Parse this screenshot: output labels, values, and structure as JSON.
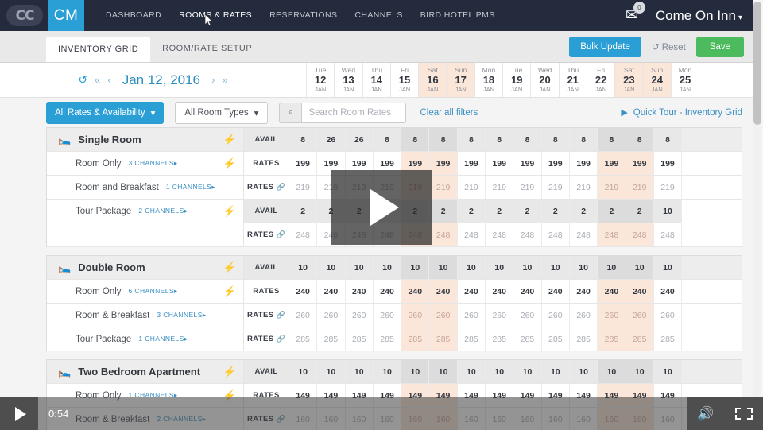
{
  "topnav": {
    "logo_cc": "CC",
    "logo_cm": "CM",
    "items": [
      {
        "label": "DASHBOARD",
        "active": false
      },
      {
        "label": "ROOMS & RATES",
        "active": true
      },
      {
        "label": "RESERVATIONS",
        "active": false
      },
      {
        "label": "CHANNELS",
        "active": false
      },
      {
        "label": "BIRD HOTEL PMS",
        "active": false
      }
    ],
    "mail_badge": "0",
    "account": "Come On Inn",
    "caret": "▾"
  },
  "subnav": {
    "tabs": [
      {
        "label": "INVENTORY GRID",
        "active": true
      },
      {
        "label": "ROOM/RATE SETUP",
        "active": false
      }
    ],
    "bulk_update": "Bulk Update",
    "reset": "Reset",
    "reset_icon": "↺",
    "save": "Save"
  },
  "datebar": {
    "refresh_icon": "↺",
    "prev_jump": "«",
    "prev": "‹",
    "label": "Jan 12, 2016",
    "next": "›",
    "next_jump": "»",
    "days": [
      {
        "dow": "Tue",
        "num": "12",
        "mon": "JAN",
        "weekend": false
      },
      {
        "dow": "Wed",
        "num": "13",
        "mon": "JAN",
        "weekend": false
      },
      {
        "dow": "Thu",
        "num": "14",
        "mon": "JAN",
        "weekend": false
      },
      {
        "dow": "Fri",
        "num": "15",
        "mon": "JAN",
        "weekend": false
      },
      {
        "dow": "Sat",
        "num": "16",
        "mon": "JAN",
        "weekend": true
      },
      {
        "dow": "Sun",
        "num": "17",
        "mon": "JAN",
        "weekend": true
      },
      {
        "dow": "Mon",
        "num": "18",
        "mon": "JAN",
        "weekend": false
      },
      {
        "dow": "Tue",
        "num": "19",
        "mon": "JAN",
        "weekend": false
      },
      {
        "dow": "Wed",
        "num": "20",
        "mon": "JAN",
        "weekend": false
      },
      {
        "dow": "Thu",
        "num": "21",
        "mon": "JAN",
        "weekend": false
      },
      {
        "dow": "Fri",
        "num": "22",
        "mon": "JAN",
        "weekend": false
      },
      {
        "dow": "Sat",
        "num": "23",
        "mon": "JAN",
        "weekend": true
      },
      {
        "dow": "Sun",
        "num": "24",
        "mon": "JAN",
        "weekend": true
      },
      {
        "dow": "Mon",
        "num": "25",
        "mon": "JAN",
        "weekend": false
      }
    ]
  },
  "filters": {
    "rates_availability": "All Rates & Availability",
    "room_types": "All Room Types",
    "search_placeholder": "Search Room Rates",
    "search_value": "",
    "clear_all": "Clear all filters",
    "quick_tour": "Quick Tour - Inventory Grid"
  },
  "grid": {
    "sections": [
      {
        "title": "Single Room",
        "rows": [
          {
            "kind": "header",
            "metric": "AVAIL",
            "metric_chain": false,
            "bolt": true,
            "values": [
              "8",
              "26",
              "26",
              "8",
              "8",
              "8",
              "8",
              "8",
              "8",
              "8",
              "8",
              "8",
              "8",
              "8"
            ]
          },
          {
            "kind": "plan",
            "name": "Room Only",
            "channels": "3 CHANNELS",
            "metric": "RATES",
            "metric_chain": false,
            "bolt": true,
            "style": "rate",
            "values": [
              "199",
              "199",
              "199",
              "199",
              "199",
              "199",
              "199",
              "199",
              "199",
              "199",
              "199",
              "199",
              "199",
              "199"
            ]
          },
          {
            "kind": "plan",
            "name": "Room and Breakfast",
            "channels": "1 CHANNELS",
            "metric": "RATES",
            "metric_chain": true,
            "bolt": false,
            "style": "pct",
            "values": [
              "219",
              "219",
              "219",
              "219",
              "219",
              "219",
              "219",
              "219",
              "219",
              "219",
              "219",
              "219",
              "219",
              "219"
            ]
          },
          {
            "kind": "plan",
            "name": "Tour Package",
            "channels": "2 CHANNELS",
            "metric": "AVAIL",
            "metric_chain": false,
            "bolt": true,
            "style": "avail",
            "values": [
              "2",
              "2",
              "2",
              "2",
              "2",
              "2",
              "2",
              "2",
              "2",
              "2",
              "2",
              "2",
              "2",
              "10"
            ]
          },
          {
            "kind": "plan",
            "name": "",
            "channels": "",
            "metric": "RATES",
            "metric_chain": true,
            "bolt": false,
            "style": "pct",
            "values": [
              "248",
              "248",
              "248",
              "248",
              "248",
              "248",
              "248",
              "248",
              "248",
              "248",
              "248",
              "248",
              "248",
              "248"
            ]
          }
        ]
      },
      {
        "title": "Double Room",
        "rows": [
          {
            "kind": "header",
            "metric": "AVAIL",
            "metric_chain": false,
            "bolt": true,
            "values": [
              "10",
              "10",
              "10",
              "10",
              "10",
              "10",
              "10",
              "10",
              "10",
              "10",
              "10",
              "10",
              "10",
              "10"
            ]
          },
          {
            "kind": "plan",
            "name": "Room Only",
            "channels": "6 CHANNELS",
            "metric": "RATES",
            "metric_chain": false,
            "bolt": true,
            "style": "rate",
            "values": [
              "240",
              "240",
              "240",
              "240",
              "240",
              "240",
              "240",
              "240",
              "240",
              "240",
              "240",
              "240",
              "240",
              "240"
            ]
          },
          {
            "kind": "plan",
            "name": "Room & Breakfast",
            "channels": "3 CHANNELS",
            "metric": "RATES",
            "metric_chain": true,
            "bolt": false,
            "style": "pct",
            "values": [
              "260",
              "260",
              "260",
              "260",
              "260",
              "260",
              "260",
              "260",
              "260",
              "260",
              "260",
              "260",
              "260",
              "260"
            ]
          },
          {
            "kind": "plan",
            "name": "Tour Package",
            "channels": "1 CHANNELS",
            "metric": "RATES",
            "metric_chain": true,
            "bolt": false,
            "style": "pct",
            "values": [
              "285",
              "285",
              "285",
              "285",
              "285",
              "285",
              "285",
              "285",
              "285",
              "285",
              "285",
              "285",
              "285",
              "285"
            ]
          }
        ]
      },
      {
        "title": "Two Bedroom Apartment",
        "rows": [
          {
            "kind": "header",
            "metric": "AVAIL",
            "metric_chain": false,
            "bolt": true,
            "values": [
              "10",
              "10",
              "10",
              "10",
              "10",
              "10",
              "10",
              "10",
              "10",
              "10",
              "10",
              "10",
              "10",
              "10"
            ]
          },
          {
            "kind": "plan",
            "name": "Room Only",
            "channels": "1 CHANNELS",
            "metric": "RATES",
            "metric_chain": false,
            "bolt": true,
            "style": "rate",
            "values": [
              "149",
              "149",
              "149",
              "149",
              "149",
              "149",
              "149",
              "149",
              "149",
              "149",
              "149",
              "149",
              "149",
              "149"
            ]
          },
          {
            "kind": "plan",
            "name": "Room & Breakfast",
            "channels": "2 CHANNELS",
            "metric": "RATES",
            "metric_chain": true,
            "bolt": false,
            "style": "pct",
            "values": [
              "160",
              "160",
              "160",
              "160",
              "160",
              "160",
              "160",
              "160",
              "160",
              "160",
              "160",
              "160",
              "160",
              "160"
            ]
          }
        ]
      }
    ]
  },
  "player": {
    "current_time": "0:54",
    "play_icon": "play-triangle",
    "volume_icon": "speaker",
    "fullscreen_icon": "expand"
  },
  "colors": {
    "nav_bg": "#242b3d",
    "accent_blue": "#2a9fd6",
    "save_green": "#4cbb5e",
    "weekend_peach": "#fbe6da",
    "avail_gray": "#e8e8e8"
  }
}
